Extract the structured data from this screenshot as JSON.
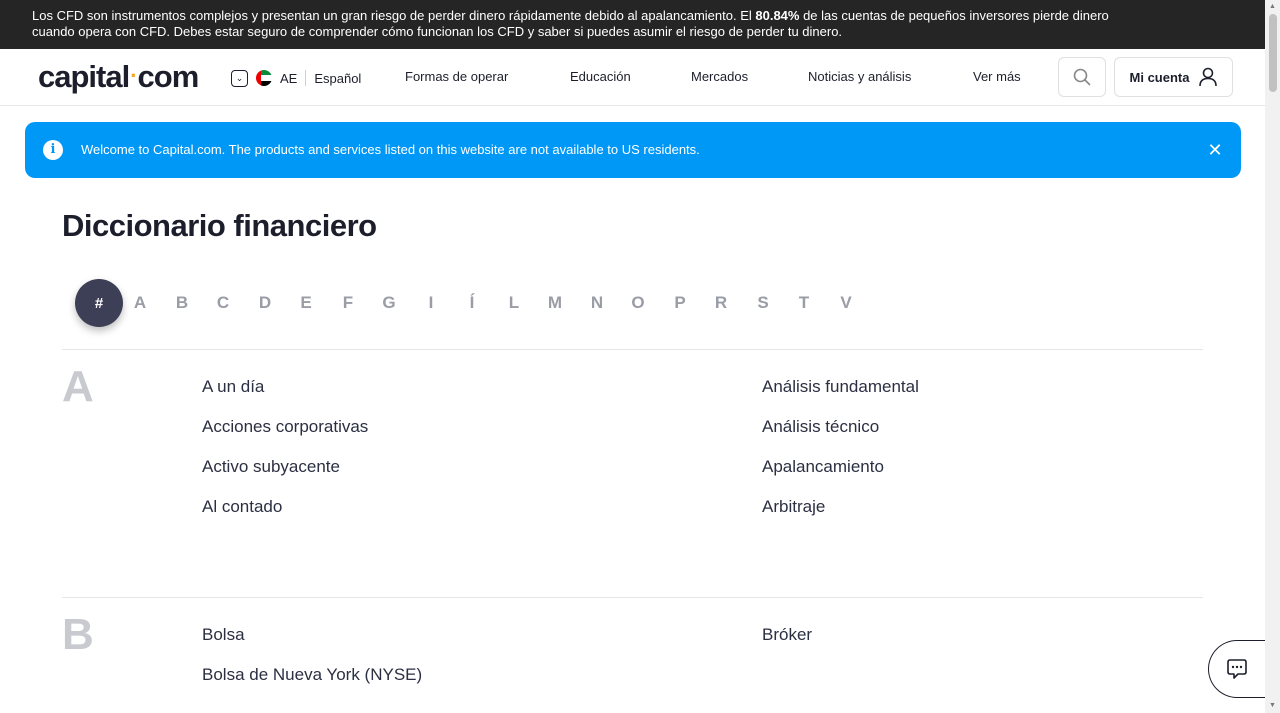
{
  "risk_warning": {
    "text_before": "Los CFD son instrumentos complejos y presentan un gran riesgo de perder dinero rápidamente debido al apalancamiento. El ",
    "percent": "80.84%",
    "text_after_line1": " de las cuentas de pequeños inversores pierde dinero",
    "text_line2": "cuando opera con CFD. Debes estar seguro de comprender cómo funcionan los CFD y saber si puedes asumir el riesgo de perder tu dinero."
  },
  "header": {
    "logo_left": "capital",
    "logo_dot": "·",
    "logo_right": "com",
    "region_code": "AE",
    "language": "Español",
    "nav": [
      "Formas de operar",
      "Educación",
      "Mercados",
      "Noticias y análisis",
      "Ver más"
    ],
    "account_label": "Mi cuenta"
  },
  "banner": {
    "info_glyph": "i",
    "message": "Welcome to Capital.com. The products and services listed on this website are not available to US residents.",
    "close_glyph": "✕"
  },
  "page": {
    "title": "Diccionario financiero"
  },
  "letters": {
    "active": "#",
    "items": [
      "A",
      "B",
      "C",
      "D",
      "E",
      "F",
      "G",
      "I",
      "Í",
      "L",
      "M",
      "N",
      "O",
      "P",
      "R",
      "S",
      "T",
      "V"
    ]
  },
  "sections": [
    {
      "letter": "A",
      "left": [
        "A un día",
        "Acciones corporativas",
        "Activo subyacente",
        "Al contado"
      ],
      "right": [
        "Análisis fundamental",
        "Análisis técnico",
        "Apalancamiento",
        "Arbitraje"
      ]
    },
    {
      "letter": "B",
      "left": [
        "Bolsa",
        "Bolsa de Nueva York (NYSE)"
      ],
      "right": [
        "Bróker"
      ]
    }
  ],
  "colors": {
    "banner": "#0098f7",
    "risk_bar": "#252525",
    "active_letter": "#3c3f55",
    "logo_dot": "#f5a623"
  }
}
